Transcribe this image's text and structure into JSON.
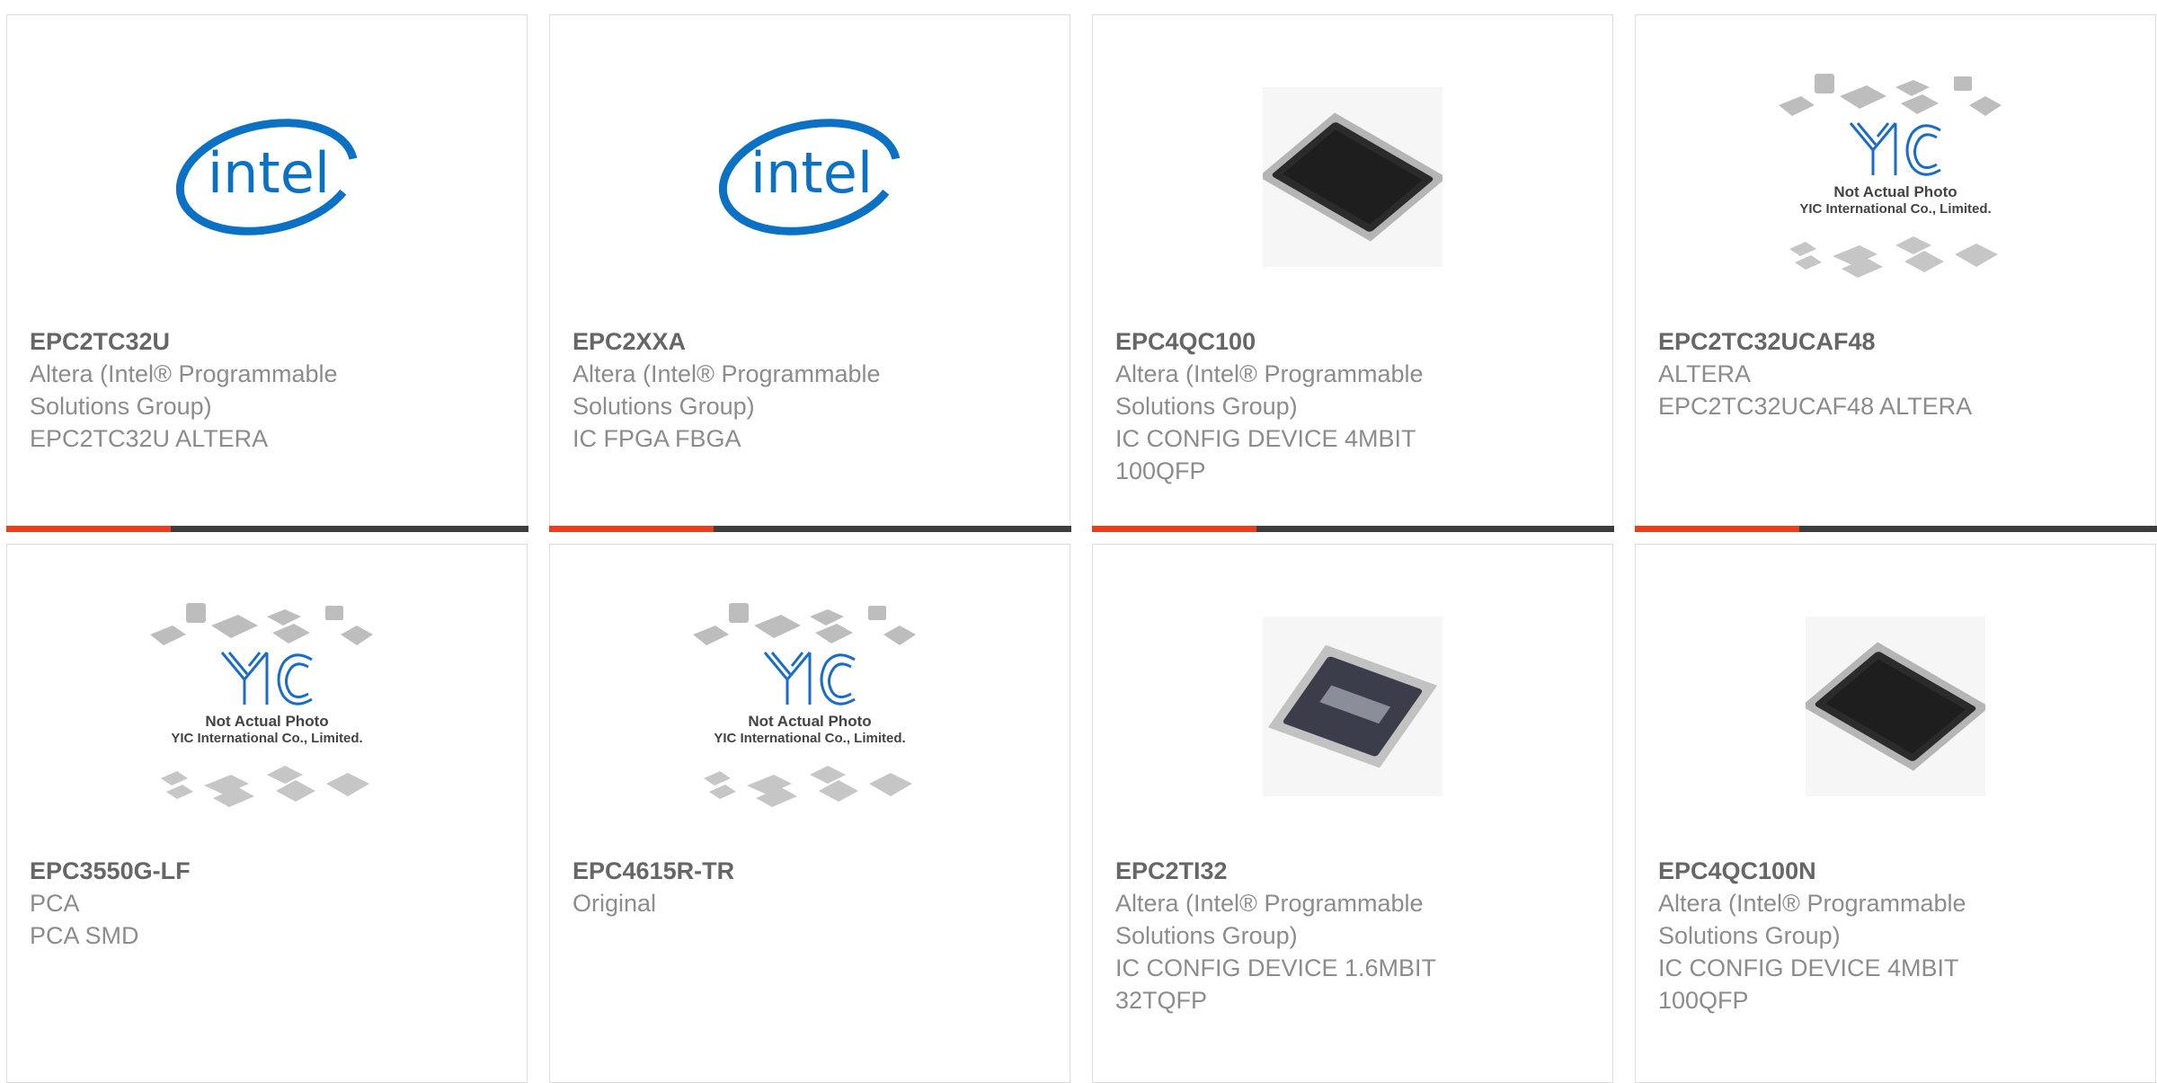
{
  "colors": {
    "accent_bar": "#e8401c",
    "dark_bar": "#3d3d3d",
    "intel_blue": "#0a71c5",
    "yic_blue": "#1a6cc9",
    "card_border": "#dcdcdc"
  },
  "products": [
    {
      "image": "intel-logo",
      "part": "EPC2TC32U",
      "manufacturer": "Altera (Intel® Programmable Solutions Group)",
      "description": "EPC2TC32U ALTERA"
    },
    {
      "image": "intel-logo",
      "part": "EPC2XXA",
      "manufacturer": "Altera (Intel® Programmable Solutions Group)",
      "description": "IC FPGA FBGA"
    },
    {
      "image": "qfp-chip",
      "part": "EPC4QC100",
      "manufacturer": "Altera (Intel® Programmable Solutions Group)",
      "description": "IC CONFIG DEVICE 4MBIT 100QFP"
    },
    {
      "image": "not-actual-photo",
      "image_text": [
        "Not Actual Photo",
        "YIC International Co., Limited."
      ],
      "part": "EPC2TC32UCAF48",
      "manufacturer": "ALTERA",
      "description": "EPC2TC32UCAF48 ALTERA"
    },
    {
      "image": "not-actual-photo",
      "image_text": [
        "Not Actual Photo",
        "YIC International Co., Limited."
      ],
      "part": "EPC3550G-LF",
      "manufacturer": "PCA",
      "description": "PCA SMD"
    },
    {
      "image": "not-actual-photo",
      "image_text": [
        "Not Actual Photo",
        "YIC International Co., Limited."
      ],
      "part": "EPC4615R-TR",
      "manufacturer": "Original",
      "description": ""
    },
    {
      "image": "tqfp-chip",
      "part": "EPC2TI32",
      "manufacturer": "Altera (Intel® Programmable Solutions Group)",
      "description": "IC CONFIG DEVICE 1.6MBIT 32TQFP"
    },
    {
      "image": "qfp-chip",
      "part": "EPC4QC100N",
      "manufacturer": "Altera (Intel® Programmable Solutions Group)",
      "description": "IC CONFIG DEVICE 4MBIT 100QFP"
    }
  ]
}
